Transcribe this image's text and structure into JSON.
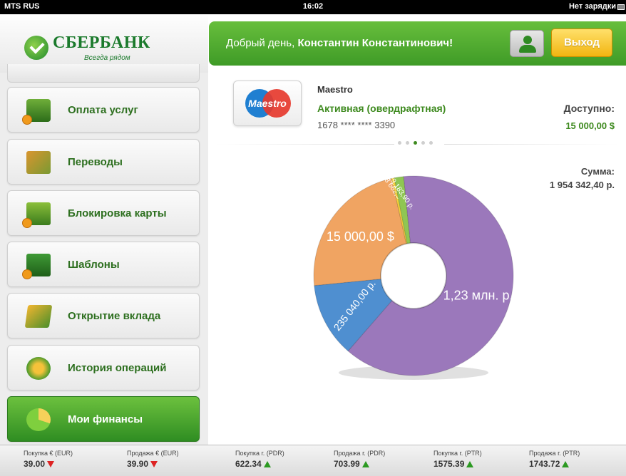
{
  "status_bar": {
    "carrier": "MTS RUS",
    "time": "16:02",
    "battery_text": "Нет зарядки"
  },
  "brand": {
    "name": "СБЕРБАНК",
    "slogan": "Всегда рядом"
  },
  "header": {
    "greeting_prefix": "Добрый день,",
    "user_name": "Константин Константинович!",
    "logout_label": "Выход"
  },
  "sidebar": {
    "items": [
      {
        "label": "Оплата услуг",
        "icon": "wallet-icon"
      },
      {
        "label": "Переводы",
        "icon": "transfer-icon"
      },
      {
        "label": "Блокировка карты",
        "icon": "lock-icon"
      },
      {
        "label": "Шаблоны",
        "icon": "folder-icon"
      },
      {
        "label": "Открытие вклада",
        "icon": "deposit-icon"
      },
      {
        "label": "История операций",
        "icon": "history-icon"
      },
      {
        "label": "Мои финансы",
        "icon": "pie-chart-icon",
        "active": true
      }
    ]
  },
  "card": {
    "logo_text": "Maestro",
    "name": "Maestro",
    "status": "Активная (овердрафтная)",
    "number": "1678 **** **** 3390",
    "available_label": "Доступно:",
    "available_value": "15 000,00 $",
    "pager_total": 5,
    "pager_current": 3
  },
  "totals": {
    "sum_label": "Сумма:",
    "sum_value": "1 954 342,40 р."
  },
  "chart_data": {
    "type": "pie",
    "donut": true,
    "slices": [
      {
        "label": "1,23 млн. р.",
        "value": 1230000,
        "color": "#9b78bb"
      },
      {
        "label": "235 040,00 р.",
        "value": 235040,
        "color": "#4f8fd0"
      },
      {
        "label": "15 000,00 $",
        "value": 450000,
        "color": "#f0a462"
      },
      {
        "label": "8 662,50 р.",
        "value": 8662.5,
        "color": "#f2cf3a"
      },
      {
        "label": "29 183,90 р.",
        "value": 29183.9,
        "color": "#8fc653"
      }
    ]
  },
  "rates": [
    {
      "label": "Покупка € (EUR)",
      "value": "39.00",
      "trend": "down"
    },
    {
      "label": "Продажа € (EUR)",
      "value": "39.90",
      "trend": "down"
    },
    {
      "label": "Покупка г. (PDR)",
      "value": "622.34",
      "trend": "up"
    },
    {
      "label": "Продажа г. (PDR)",
      "value": "703.99",
      "trend": "up"
    },
    {
      "label": "Покупка г. (PTR)",
      "value": "1575.39",
      "trend": "up"
    },
    {
      "label": "Продажа г. (PTR)",
      "value": "1743.72",
      "trend": "up"
    }
  ]
}
